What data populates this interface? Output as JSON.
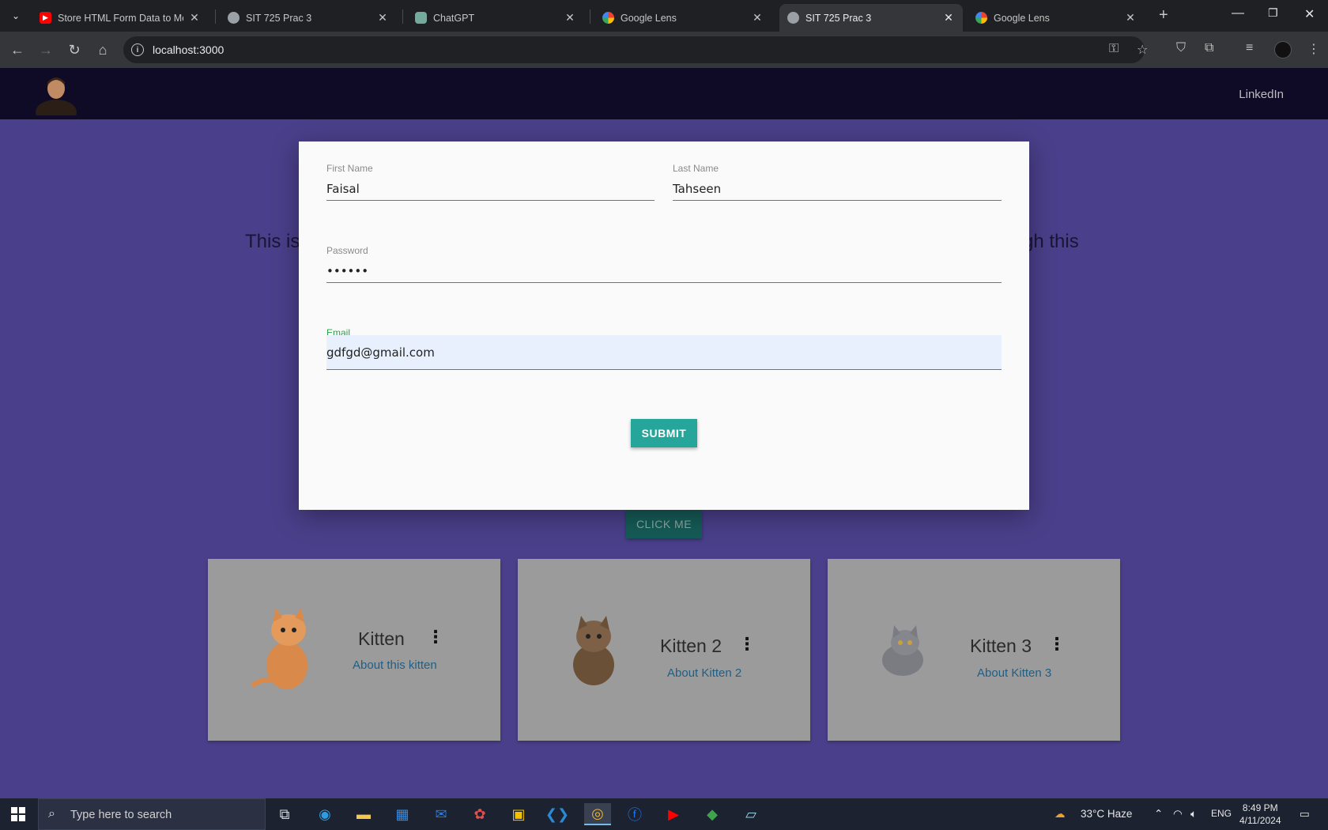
{
  "browser": {
    "tabs": [
      {
        "title": "Store HTML Form Data to Mong",
        "favicon": "youtube-icon",
        "color": "#ff0000"
      },
      {
        "title": "SIT 725 Prac 3",
        "favicon": "globe-icon",
        "color": "#9aa0a6"
      },
      {
        "title": "ChatGPT",
        "favicon": "chatgpt-icon",
        "color": "#74aa9c"
      },
      {
        "title": "Google Lens",
        "favicon": "google-lens-icon",
        "color": "#4285f4"
      },
      {
        "title": "SIT 725 Prac 3",
        "favicon": "globe-icon",
        "color": "#9aa0a6",
        "active": true
      },
      {
        "title": "Google Lens",
        "favicon": "google-lens-icon",
        "color": "#4285f4"
      }
    ],
    "url": "localhost:3000"
  },
  "page": {
    "nav_link": "LinkedIn",
    "bg_text_left": "This is",
    "bg_text_right": "gh this",
    "click_me_label": "CLICK ME",
    "cards": [
      {
        "title": "Kitten",
        "link": "About this kitten",
        "image": "orange-kitten"
      },
      {
        "title": "Kitten 2",
        "link": "About Kitten 2",
        "image": "tabby-kitten"
      },
      {
        "title": "Kitten 3",
        "link": "About Kitten 3",
        "image": "grey-kitten"
      }
    ]
  },
  "modal": {
    "first_name_label": "First Name",
    "first_name_value": "Faisal",
    "last_name_label": "Last Name",
    "last_name_value": "Tahseen",
    "password_label": "Password",
    "password_value": "••••••",
    "email_label": "Email",
    "email_value": "gdfgd@gmail.com",
    "submit_label": "SUBMIT"
  },
  "taskbar": {
    "search_placeholder": "Type here to search",
    "weather": "33°C  Haze",
    "language": "ENG",
    "time": "8:49 PM",
    "date": "4/11/2024"
  },
  "colors": {
    "page_bg": "#4a3f8a",
    "navbar_bg": "#0f0b26",
    "accent_green": "#26a348",
    "submit_teal": "#26a69a"
  }
}
